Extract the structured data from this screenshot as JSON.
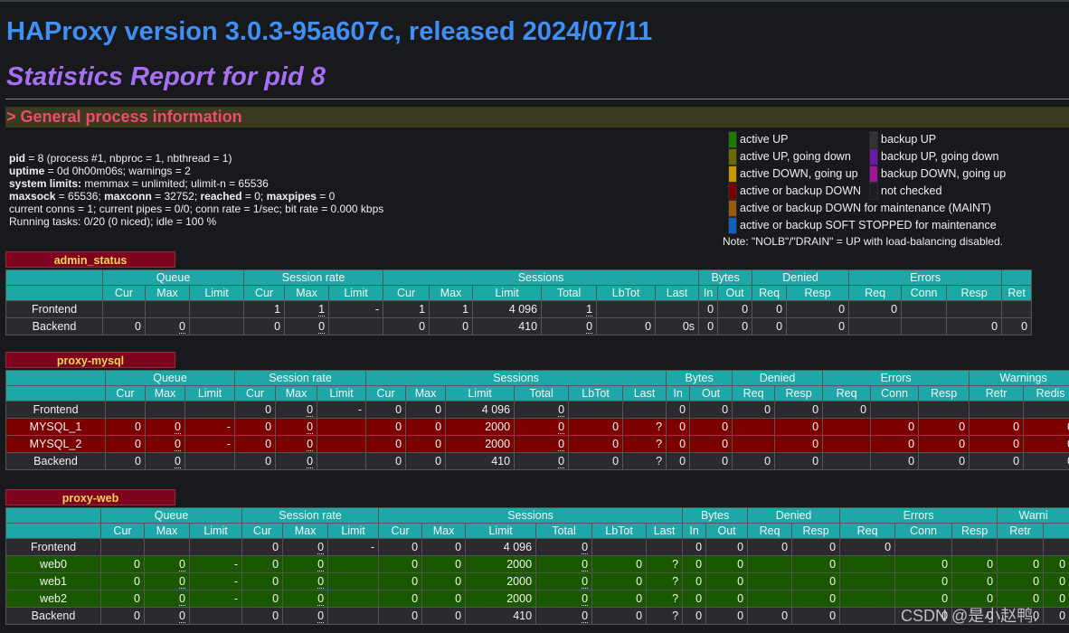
{
  "header": {
    "version_title": "HAProxy version 3.0.3-95a607c, released 2024/07/11",
    "report_title": "Statistics Report for pid 8",
    "section_title": "> General process information"
  },
  "process_info": [
    {
      "key": "pid",
      "value": " = 8 (process #1, nbproc = 1, nbthread = 1)"
    },
    {
      "key": "uptime",
      "value": " = 0d 0h00m06s; warnings = 2"
    },
    {
      "key": "system limits:",
      "value": " memmax = unlimited; ulimit-n = 65536"
    },
    {
      "key": "maxsock",
      "value": " = 65536; ",
      "key2": "maxconn",
      "value2": " = 32752; ",
      "key3": "reached",
      "value3": " = 0; ",
      "key4": "maxpipes",
      "value4": " = 0"
    },
    {
      "key": "",
      "value": "current conns = 1; current pipes = 0/0; conn rate = 1/sec; bit rate = 0.000 kbps"
    },
    {
      "key": "",
      "value": "Running tasks: 0/20 (0 niced); idle = 100 %"
    }
  ],
  "legend": {
    "items": [
      {
        "label": "active UP",
        "color": "#1c7a00"
      },
      {
        "label": "active UP, going down",
        "color": "#6b6b00"
      },
      {
        "label": "active DOWN, going up",
        "color": "#c89a00"
      },
      {
        "label": "active or backup DOWN",
        "color": "#7c0000"
      },
      {
        "label": "active or backup DOWN for maintenance (MAINT)",
        "color": "#9a5a10"
      },
      {
        "label": "active or backup SOFT STOPPED for maintenance",
        "color": "#1060c0"
      },
      {
        "label": "backup UP",
        "color": "#333338"
      },
      {
        "label": "backup UP, going down",
        "color": "#6a1aa8"
      },
      {
        "label": "backup DOWN, going up",
        "color": "#a0149a"
      },
      {
        "label": "not checked",
        "color": "#1e1e22"
      }
    ],
    "note": "Note: \"NOLB\"/\"DRAIN\" = UP with load-balancing disabled."
  },
  "proxies": [
    {
      "name": "admin_status",
      "groups": [
        {
          "label": "Queue",
          "span": 3
        },
        {
          "label": "Session rate",
          "span": 3
        },
        {
          "label": "Sessions",
          "span": 6
        },
        {
          "label": "Bytes",
          "span": 2
        },
        {
          "label": "Denied",
          "span": 2
        },
        {
          "label": "Errors",
          "span": 3
        },
        {
          "label": "",
          "span": 1
        }
      ],
      "subcols": [
        "Cur",
        "Max",
        "Limit",
        "Cur",
        "Max",
        "Limit",
        "Cur",
        "Max",
        "Limit",
        "Total",
        "LbTot",
        "Last",
        "In",
        "Out",
        "Req",
        "Resp",
        "Req",
        "Conn",
        "Resp",
        "Ret"
      ],
      "widths": [
        107,
        47,
        49,
        60,
        45,
        49,
        60,
        51,
        48,
        76,
        61,
        65,
        48,
        21,
        38,
        38,
        69,
        58,
        50,
        61,
        33
      ],
      "rows": [
        {
          "name": "Frontend",
          "kind": "front",
          "cells": [
            "",
            "",
            "",
            "1",
            "1",
            "-",
            "1",
            "1",
            "4 096",
            "1",
            "",
            "",
            "0",
            "0",
            "0",
            "0",
            "0",
            "",
            "",
            ""
          ]
        },
        {
          "name": "Backend",
          "kind": "back",
          "cells": [
            "0",
            "0",
            "",
            "0",
            "0",
            "",
            "0",
            "0",
            "410",
            "0",
            "0",
            "0s",
            "0",
            "0",
            "0",
            "0",
            "",
            "",
            "0",
            "0"
          ]
        }
      ]
    },
    {
      "name": "proxy-mysql",
      "groups": [
        {
          "label": "Queue",
          "span": 3
        },
        {
          "label": "Session rate",
          "span": 3
        },
        {
          "label": "Sessions",
          "span": 6
        },
        {
          "label": "Bytes",
          "span": 2
        },
        {
          "label": "Denied",
          "span": 2
        },
        {
          "label": "Errors",
          "span": 3
        },
        {
          "label": "Warnings",
          "span": 2
        },
        {
          "label": "",
          "span": 1
        }
      ],
      "subcols": [
        "Cur",
        "Max",
        "Limit",
        "Cur",
        "Max",
        "Limit",
        "Cur",
        "Max",
        "Limit",
        "Total",
        "LbTot",
        "Last",
        "In",
        "Out",
        "Req",
        "Resp",
        "Req",
        "Conn",
        "Resp",
        "Retr",
        "Redis",
        ""
      ],
      "widths": [
        110,
        44,
        44,
        55,
        45,
        46,
        54,
        44,
        44,
        76,
        60,
        60,
        48,
        26,
        47,
        47,
        53,
        53,
        53,
        56,
        60,
        60,
        16
      ],
      "rows": [
        {
          "name": "Frontend",
          "kind": "front",
          "cells": [
            "",
            "",
            "",
            "0",
            "0",
            "-",
            "0",
            "0",
            "4 096",
            "0",
            "",
            "",
            "0",
            "0",
            "0",
            "0",
            "0",
            "",
            "",
            "",
            "",
            ""
          ]
        },
        {
          "name": "MYSQL_1",
          "kind": "down",
          "cells": [
            "0",
            "0",
            "-",
            "0",
            "0",
            "",
            "0",
            "0",
            "2000",
            "0",
            "0",
            "?",
            "0",
            "0",
            "",
            "0",
            "",
            "0",
            "0",
            "0",
            "0",
            ""
          ]
        },
        {
          "name": "MYSQL_2",
          "kind": "down",
          "cells": [
            "0",
            "0",
            "-",
            "0",
            "0",
            "",
            "0",
            "0",
            "2000",
            "0",
            "0",
            "?",
            "0",
            "0",
            "",
            "0",
            "",
            "0",
            "0",
            "0",
            "0",
            ""
          ]
        },
        {
          "name": "Backend",
          "kind": "back",
          "cells": [
            "0",
            "0",
            "",
            "0",
            "0",
            "",
            "0",
            "0",
            "410",
            "0",
            "0",
            "?",
            "0",
            "0",
            "0",
            "0",
            "",
            "0",
            "0",
            "0",
            "0",
            ""
          ]
        }
      ]
    },
    {
      "name": "proxy-web",
      "groups": [
        {
          "label": "Queue",
          "span": 3
        },
        {
          "label": "Session rate",
          "span": 3
        },
        {
          "label": "Sessions",
          "span": 6
        },
        {
          "label": "Bytes",
          "span": 2
        },
        {
          "label": "Denied",
          "span": 2
        },
        {
          "label": "Errors",
          "span": 3
        },
        {
          "label": "Warni",
          "span": 2
        }
      ],
      "subcols": [
        "Cur",
        "Max",
        "Limit",
        "Cur",
        "Max",
        "Limit",
        "Cur",
        "Max",
        "Limit",
        "Total",
        "LbTot",
        "Last",
        "In",
        "Out",
        "Req",
        "Resp",
        "Req",
        "Conn",
        "Resp",
        "Retr",
        ""
      ],
      "widths": [
        105,
        48,
        50,
        58,
        45,
        50,
        56,
        48,
        48,
        78,
        62,
        60,
        40,
        26,
        46,
        49,
        53,
        61,
        63,
        50,
        51,
        29
      ],
      "rows": [
        {
          "name": "Frontend",
          "kind": "front",
          "cells": [
            "",
            "",
            "",
            "0",
            "0",
            "-",
            "0",
            "0",
            "4 096",
            "0",
            "",
            "",
            "0",
            "0",
            "0",
            "0",
            "0",
            "",
            "",
            "",
            ""
          ]
        },
        {
          "name": "web0",
          "kind": "up",
          "cells": [
            "0",
            "0",
            "-",
            "0",
            "0",
            "",
            "0",
            "0",
            "2000",
            "0",
            "0",
            "?",
            "0",
            "0",
            "",
            "0",
            "",
            "0",
            "0",
            "0",
            "0"
          ]
        },
        {
          "name": "web1",
          "kind": "up",
          "cells": [
            "0",
            "0",
            "-",
            "0",
            "0",
            "",
            "0",
            "0",
            "2000",
            "0",
            "0",
            "?",
            "0",
            "0",
            "",
            "0",
            "",
            "0",
            "0",
            "0",
            "0"
          ]
        },
        {
          "name": "web2",
          "kind": "up",
          "cells": [
            "0",
            "0",
            "-",
            "0",
            "0",
            "",
            "0",
            "0",
            "2000",
            "0",
            "0",
            "?",
            "0",
            "0",
            "",
            "0",
            "",
            "0",
            "0",
            "0",
            "0"
          ]
        },
        {
          "name": "Backend",
          "kind": "back",
          "cells": [
            "0",
            "0",
            "",
            "0",
            "0",
            "",
            "0",
            "0",
            "410",
            "0",
            "0",
            "?",
            "0",
            "0",
            "0",
            "0",
            "",
            "0",
            "0",
            "0",
            "0"
          ]
        }
      ]
    }
  ],
  "watermark": "CSDN @是小赵鸭."
}
